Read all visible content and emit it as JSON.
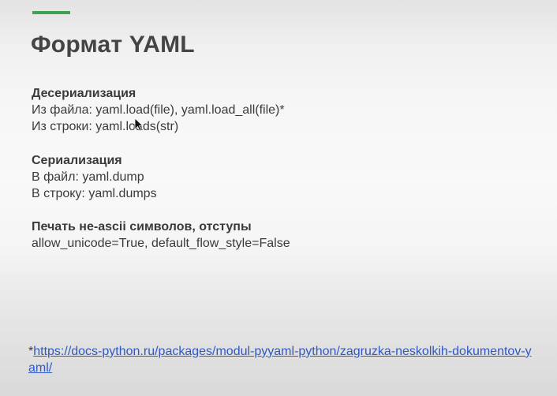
{
  "slide": {
    "title": "Формат YAML",
    "accent_color": "#3fa34d",
    "sections": [
      {
        "heading": "Десериализация",
        "lines": [
          "Из файла: yaml.load(file), yaml.load_all(file)*",
          "Из строки: yaml.loads(str)"
        ]
      },
      {
        "heading": "Сериализация",
        "lines": [
          "В файл: yaml.dump",
          "В строку: yaml.dumps"
        ]
      },
      {
        "heading": "Печать не-ascii символов, отступы",
        "lines": [
          "allow_unicode=True, default_flow_style=False"
        ]
      }
    ],
    "footnote": {
      "marker": "*",
      "link_text": "https://docs-python.ru/packages/modul-pyyaml-python/zagruzka-neskolkih-dokumentov-yaml/"
    }
  },
  "pointer": "mouse-pointer-icon"
}
